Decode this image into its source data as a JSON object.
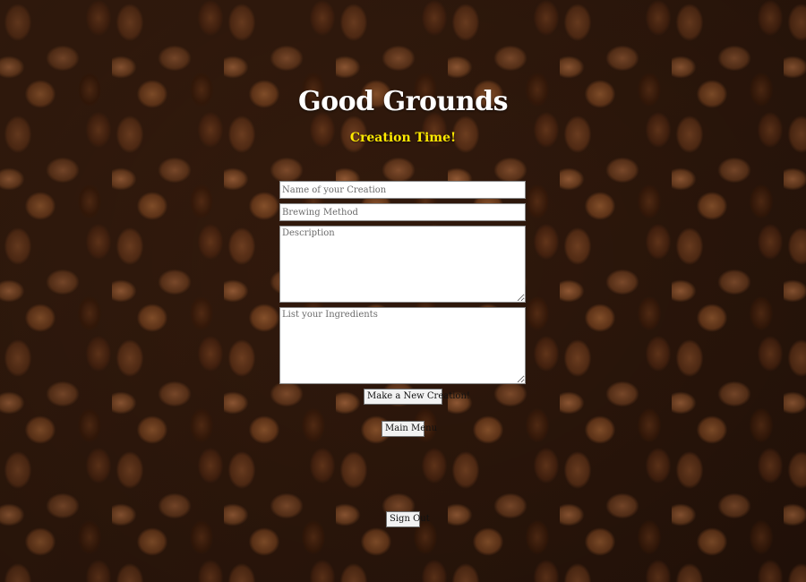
{
  "header": {
    "title": "Good Grounds",
    "subtitle": "Creation Time!"
  },
  "form": {
    "name_placeholder": "Name of your Creation",
    "brewing_placeholder": "Brewing Method",
    "description_placeholder": "Description",
    "ingredients_placeholder": "List your Ingredients",
    "name_value": "",
    "brewing_value": "",
    "description_value": "",
    "ingredients_value": ""
  },
  "buttons": {
    "make_label": "Make a New Creation!",
    "menu_label": "Main Menu",
    "signout_label": "Sign Out"
  },
  "colors": {
    "title": "#ffffff",
    "subtitle": "#ffea00",
    "background": "#2a160b"
  }
}
